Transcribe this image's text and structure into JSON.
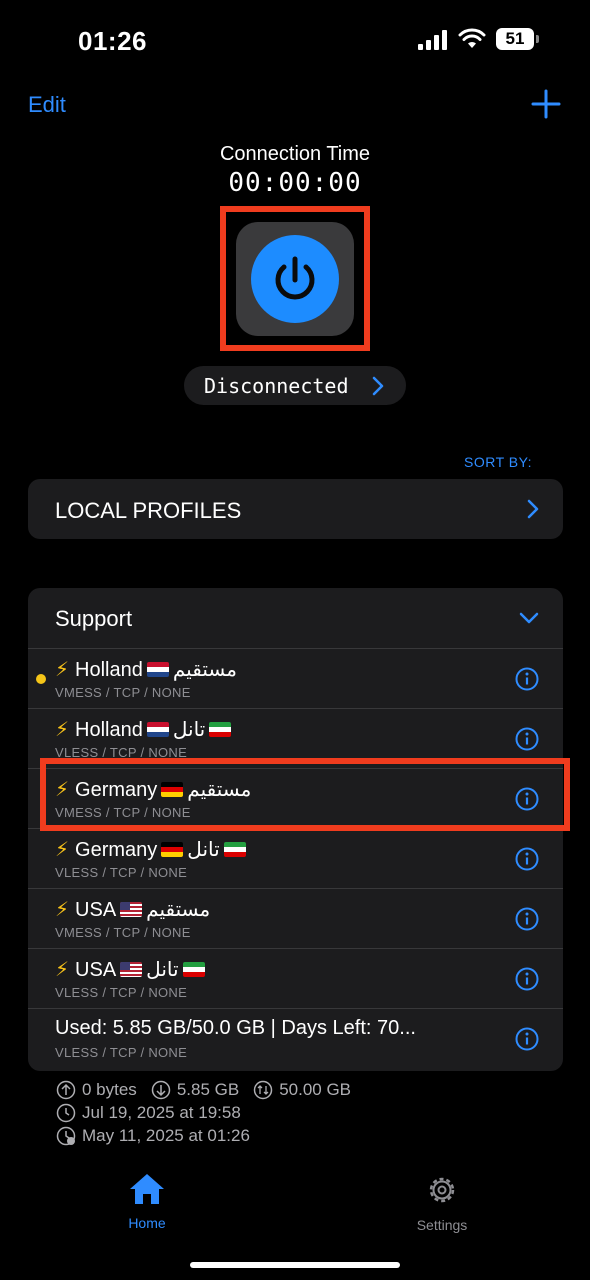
{
  "status_bar": {
    "time": "01:26",
    "battery": "51"
  },
  "nav": {
    "edit_label": "Edit"
  },
  "connection": {
    "title": "Connection Time",
    "timer": "00:00:00",
    "status": "Disconnected"
  },
  "sort_label": "SORT BY:",
  "local_profiles_label": "LOCAL PROFILES",
  "support": {
    "header": "Support",
    "rows": [
      {
        "name": "Holland",
        "suffix": "مستقیم",
        "sub": "VMESS / TCP / NONE"
      },
      {
        "name": "Holland",
        "suffix": "تانل",
        "sub": "VLESS / TCP / NONE"
      },
      {
        "name": "Germany",
        "suffix": "مستقیم",
        "sub": "VMESS / TCP / NONE"
      },
      {
        "name": "Germany",
        "suffix": "تانل",
        "sub": "VLESS / TCP / NONE"
      },
      {
        "name": "USA",
        "suffix": "مستقیم",
        "sub": "VMESS / TCP / NONE"
      },
      {
        "name": "USA",
        "suffix": "تانل",
        "sub": "VLESS / TCP / NONE"
      },
      {
        "name": "Used: 5.85 GB/50.0 GB | Days Left: 70...",
        "sub": "VLESS / TCP / NONE"
      }
    ]
  },
  "stats": {
    "upload": "0 bytes",
    "download": "5.85 GB",
    "total": "50.00 GB",
    "expires": "Jul 19, 2025 at 19:58",
    "updated": "May 11, 2025 at 01:26"
  },
  "tabs": {
    "home": "Home",
    "settings": "Settings"
  },
  "colors": {
    "accent": "#2f8cff",
    "highlight": "#f03c1e",
    "card": "#1c1c1e",
    "active_dot": "#f5c518"
  }
}
